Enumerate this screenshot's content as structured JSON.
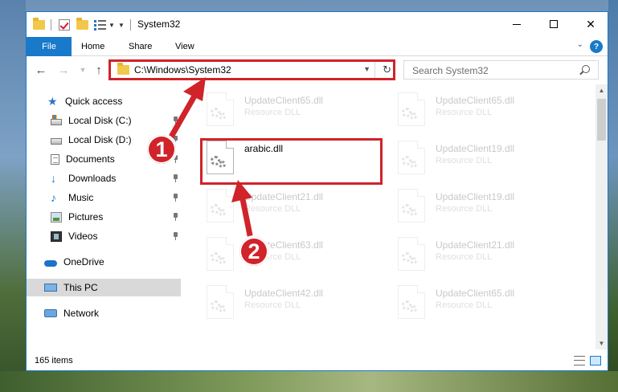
{
  "window": {
    "title": "System32",
    "controls": {
      "minimize": "",
      "maximize": "",
      "close": "✕"
    }
  },
  "ribbon": {
    "tabs": [
      {
        "label": "File"
      },
      {
        "label": "Home"
      },
      {
        "label": "Share"
      },
      {
        "label": "View"
      }
    ],
    "help": "?"
  },
  "navigation": {
    "address": "C:\\Windows\\System32",
    "search_placeholder": "Search System32"
  },
  "sidebar": {
    "items": [
      {
        "label": "Quick access",
        "icon": "star-icon"
      },
      {
        "label": "Local Disk (C:)",
        "icon": "local-disk-icon",
        "pinned": true
      },
      {
        "label": "Local Disk (D:)",
        "icon": "local-disk-icon",
        "pinned": true
      },
      {
        "label": "Documents",
        "icon": "documents-icon",
        "pinned": true
      },
      {
        "label": "Downloads",
        "icon": "downloads-icon",
        "pinned": true
      },
      {
        "label": "Music",
        "icon": "music-icon",
        "pinned": true
      },
      {
        "label": "Pictures",
        "icon": "pictures-icon",
        "pinned": true
      },
      {
        "label": "Videos",
        "icon": "videos-icon",
        "pinned": true
      },
      {
        "label": "OneDrive",
        "icon": "onedrive-icon"
      },
      {
        "label": "This PC",
        "icon": "this-pc-icon",
        "selected": true
      },
      {
        "label": "Network",
        "icon": "network-icon"
      }
    ]
  },
  "files": {
    "left_column": [
      {
        "name": "UpdateClient65.dll",
        "type": "Resource DLL",
        "faded": true
      },
      {
        "name": "arabic.dll",
        "type": "",
        "faded": false,
        "highlighted": true
      },
      {
        "name": "UpdateClient21.dll",
        "type": "Resource DLL",
        "faded": true
      },
      {
        "name": "UpdateClient63.dll",
        "type": "Resource DLL",
        "faded": true
      },
      {
        "name": "UpdateClient42.dll",
        "type": "Resource DLL",
        "faded": true
      }
    ],
    "right_column": [
      {
        "name": "UpdateClient65.dll",
        "type": "Resource DLL",
        "faded": true
      },
      {
        "name": "UpdateClient19.dll",
        "type": "Resource DLL",
        "faded": true
      },
      {
        "name": "UpdateClient19.dll",
        "type": "Resource DLL",
        "faded": true
      },
      {
        "name": "UpdateClient21.dll",
        "type": "Resource DLL",
        "faded": true
      },
      {
        "name": "UpdateClient65.dll",
        "type": "Resource DLL",
        "faded": true
      }
    ]
  },
  "status": {
    "item_count": "165 items"
  },
  "annotations": {
    "callouts": [
      "1",
      "2"
    ],
    "color": "#d0232a"
  },
  "colors": {
    "accent": "#1979ca",
    "selection": "#d9d9d9",
    "annotation": "#d0232a"
  }
}
